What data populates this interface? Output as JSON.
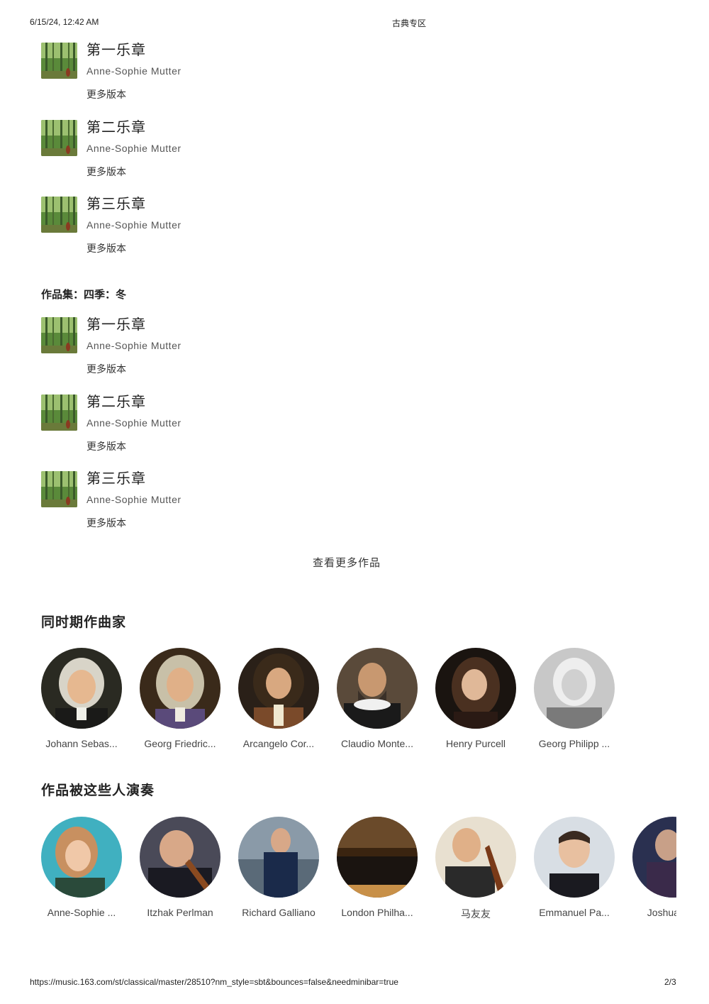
{
  "print_header": {
    "datetime": "6/15/24, 12:42 AM",
    "title": "古典专区"
  },
  "print_footer": {
    "url": "https://music.163.com/st/classical/master/28510?nm_style=sbt&bounces=false&needminibar=true",
    "page": "2/3"
  },
  "groups": [
    {
      "title": "",
      "tracks": [
        {
          "name": "第一乐章",
          "artist": "Anne-Sophie Mutter",
          "more": "更多版本"
        },
        {
          "name": "第二乐章",
          "artist": "Anne-Sophie Mutter",
          "more": "更多版本"
        },
        {
          "name": "第三乐章",
          "artist": "Anne-Sophie Mutter",
          "more": "更多版本"
        }
      ]
    },
    {
      "title": "作品集：四季：冬",
      "tracks": [
        {
          "name": "第一乐章",
          "artist": "Anne-Sophie Mutter",
          "more": "更多版本"
        },
        {
          "name": "第二乐章",
          "artist": "Anne-Sophie Mutter",
          "more": "更多版本"
        },
        {
          "name": "第三乐章",
          "artist": "Anne-Sophie Mutter",
          "more": "更多版本"
        }
      ]
    }
  ],
  "view_more_label": "查看更多作品",
  "composers_section": {
    "title": "同时期作曲家",
    "items": [
      {
        "name": "Johann Sebas...",
        "tone": "#6b5a3a"
      },
      {
        "name": "Georg Friedric...",
        "tone": "#7a6040"
      },
      {
        "name": "Arcangelo Cor...",
        "tone": "#5a4030"
      },
      {
        "name": "Claudio Monte...",
        "tone": "#4a3525"
      },
      {
        "name": "Henry Purcell",
        "tone": "#3a2a20"
      },
      {
        "name": "Georg Philipp ...",
        "tone": "#9a9a9a"
      }
    ]
  },
  "performers_section": {
    "title": "作品被这些人演奏",
    "items": [
      {
        "name": "Anne-Sophie ...",
        "tone": "#3aa0b0"
      },
      {
        "name": "Itzhak Perlman",
        "tone": "#3a3a4a"
      },
      {
        "name": "Richard Galliano",
        "tone": "#2a3a55"
      },
      {
        "name": "London Philha...",
        "tone": "#5a3a20"
      },
      {
        "name": "马友友",
        "tone": "#d8d0c0"
      },
      {
        "name": "Emmanuel Pa...",
        "tone": "#c0c8d0"
      },
      {
        "name": "Joshua Bell",
        "tone": "#2a3050"
      }
    ]
  }
}
